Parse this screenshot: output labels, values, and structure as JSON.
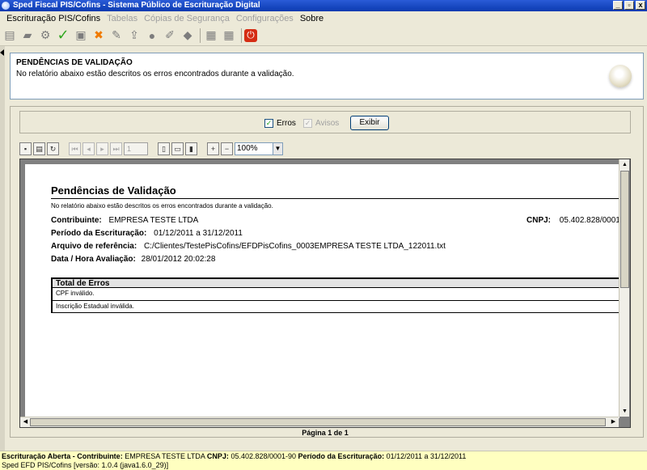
{
  "window": {
    "title": "Sped Fiscal PIS/Cofins - Sistema Público de Escrituração Digital",
    "controls": [
      "_",
      "▫",
      "x"
    ]
  },
  "menu": [
    {
      "label": "Escrituração PIS/Cofins",
      "enabled": true
    },
    {
      "label": "Tabelas",
      "enabled": false
    },
    {
      "label": "Cópias de Segurança",
      "enabled": false
    },
    {
      "label": "Configurações",
      "enabled": false
    },
    {
      "label": "Sobre",
      "enabled": true
    }
  ],
  "toolbar": {
    "icons": [
      "new-file-icon",
      "open-folder-icon",
      "import-icon",
      "validate-check-icon",
      "print-icon",
      "delete-icon",
      "sign-icon",
      "export-icon",
      "globe-icon",
      "edit-icon",
      "shield-icon",
      "save-icon",
      "save-as-icon",
      "exit-icon"
    ]
  },
  "header": {
    "title": "PENDÊNCIAS DE VALIDAÇÃO",
    "description": "No relatório abaixo estão descritos os erros encontrados durante a validação."
  },
  "filter": {
    "erros_label": "Erros",
    "erros_checked": true,
    "avisos_label": "Avisos",
    "avisos_checked": false,
    "button_label": "Exibir"
  },
  "viewer": {
    "page_number": "1",
    "zoom": "100%"
  },
  "report": {
    "title": "Pendências de Validação",
    "description": "No relatório abaixo estão descritos os erros encontrados durante a validação.",
    "contribuinte_label": "Contribuinte:",
    "contribuinte_value": "EMPRESA TESTE LTDA",
    "cnpj_label": "CNPJ:",
    "cnpj_value": "05.402.828/0001",
    "periodo_label": "Período da Escrituração:",
    "periodo_value": "01/12/2011 a 31/12/2011",
    "arquivo_label": "Arquivo de referência:",
    "arquivo_value": "C:/Clientes/TestePisCofins/EFDPisCofins_0003EMPRESA TESTE LTDA_122011.txt",
    "data_label": "Data / Hora Avaliação:",
    "data_value": "28/01/2012 20:02:28",
    "table_header": "Total de Erros",
    "errors": [
      "CPF inválido.",
      "Inscrição Estadual inválida."
    ]
  },
  "page_indicator": "Página 1 de 1",
  "status": {
    "line1_label1": "Escrituração Aberta - Contribuinte:",
    "line1_value1": "EMPRESA TESTE LTDA",
    "line1_label2": "CNPJ:",
    "line1_value2": "05.402.828/0001-90",
    "line1_label3": "Período da Escrituração:",
    "line1_value3": "01/12/2011 a 31/12/2011",
    "line2": "Sped EFD PIS/Cofins [versão: 1.0.4 (java1.6.0_29)]"
  }
}
